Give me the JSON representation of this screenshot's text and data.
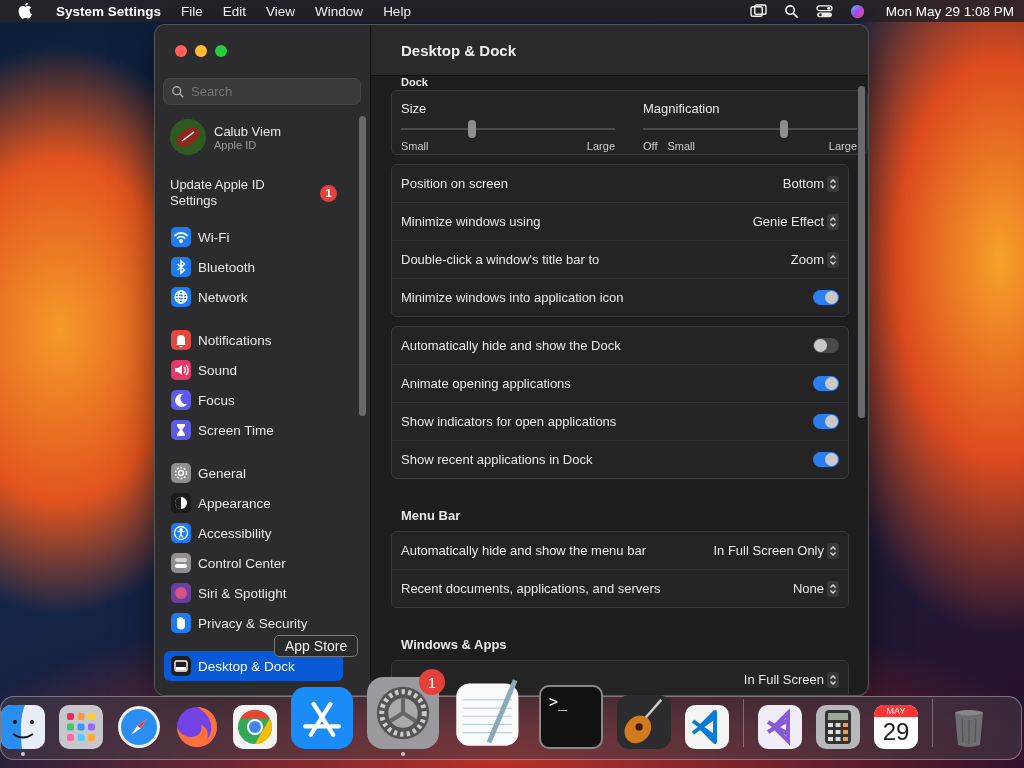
{
  "menu_bar": {
    "app_name": "System Settings",
    "menus": [
      "File",
      "Edit",
      "View",
      "Window",
      "Help"
    ],
    "clock": "Mon May 29  1:08 PM"
  },
  "window": {
    "title": "Desktop & Dock",
    "sidebar": {
      "search": {
        "placeholder": "Search"
      },
      "account": {
        "name": "Calub Viem",
        "subtitle": "Apple ID"
      },
      "notice": {
        "label": "Update Apple ID Settings",
        "badge": "1"
      },
      "groups": [
        [
          {
            "label": "Wi-Fi",
            "kind": "wifi",
            "color": "#1e7cf2",
            "selected": false
          },
          {
            "label": "Bluetooth",
            "kind": "bluetooth",
            "color": "#1e7cf2",
            "selected": false
          },
          {
            "label": "Network",
            "kind": "globe",
            "color": "#1e7cf2",
            "selected": false
          }
        ],
        [
          {
            "label": "Notifications",
            "kind": "bell",
            "color": "#e8453c",
            "selected": false
          },
          {
            "label": "Sound",
            "kind": "speaker",
            "color": "#e8386a",
            "selected": false
          },
          {
            "label": "Focus",
            "kind": "moon",
            "color": "#5e5ce6",
            "selected": false
          },
          {
            "label": "Screen Time",
            "kind": "hourglass",
            "color": "#5e5ce6",
            "selected": false
          }
        ],
        [
          {
            "label": "General",
            "kind": "gear",
            "color": "#8e8e93",
            "selected": false
          },
          {
            "label": "Appearance",
            "kind": "contrast",
            "color": "#1c1c1e",
            "selected": false
          },
          {
            "label": "Accessibility",
            "kind": "person",
            "color": "#1e7cf2",
            "selected": false
          },
          {
            "label": "Control Center",
            "kind": "switches",
            "color": "#8e8e93",
            "selected": false
          },
          {
            "label": "Siri & Spotlight",
            "kind": "orb",
            "color": "#6b3fa0",
            "selected": false
          },
          {
            "label": "Privacy & Security",
            "kind": "hand",
            "color": "#1e7cf2",
            "selected": false
          }
        ],
        [
          {
            "label": "Desktop & Dock",
            "kind": "dock",
            "color": "#1c1c1e",
            "selected": true
          }
        ]
      ]
    },
    "sections": [
      {
        "heading": "Dock",
        "sliders": [
          {
            "label": "Size",
            "level": 0.33,
            "scale": [
              "Small",
              "Large"
            ]
          },
          {
            "label": "Magnification",
            "level": 0.66,
            "scale": [
              "Off",
              "Small",
              "Large"
            ]
          }
        ],
        "groups": [
          [
            {
              "kind": "popup",
              "label": "Position on screen",
              "value": "Bottom"
            },
            {
              "kind": "popup",
              "label": "Minimize windows using",
              "value": "Genie Effect"
            },
            {
              "kind": "popup",
              "label": "Double-click a window's title bar to",
              "value": "Zoom"
            },
            {
              "kind": "toggle",
              "label": "Minimize windows into application icon",
              "on": true
            }
          ],
          [
            {
              "kind": "toggle",
              "label": "Automatically hide and show the Dock",
              "on": false
            },
            {
              "kind": "toggle",
              "label": "Animate opening applications",
              "on": true
            },
            {
              "kind": "toggle",
              "label": "Show indicators for open applications",
              "on": true
            },
            {
              "kind": "toggle",
              "label": "Show recent applications in Dock",
              "on": true
            }
          ]
        ]
      },
      {
        "heading": "Menu Bar",
        "groups": [
          [
            {
              "kind": "popup",
              "label": "Automatically hide and show the menu bar",
              "value": "In Full Screen Only"
            },
            {
              "kind": "popup",
              "label": "Recent documents, applications, and servers",
              "value": "None"
            }
          ]
        ]
      },
      {
        "heading": "Windows & Apps",
        "groups": [
          [
            {
              "kind": "popup",
              "value": "In Full Screen"
            }
          ]
        ]
      }
    ]
  },
  "tooltip": "App Store",
  "dock": {
    "apps": [
      {
        "kind": "finder",
        "running": true
      },
      {
        "kind": "launchpad"
      },
      {
        "kind": "compass"
      },
      {
        "kind": "firefox"
      },
      {
        "kind": "chrome"
      },
      {
        "kind": "appstore"
      },
      {
        "kind": "settings",
        "running": true,
        "badge": "1"
      },
      {
        "kind": "textedit"
      },
      {
        "kind": "terminal",
        "glyph": ">_"
      },
      {
        "kind": "guitar"
      },
      {
        "kind": "vscode"
      },
      {
        "kind": "divider"
      },
      {
        "kind": "vstudio"
      },
      {
        "kind": "calculator"
      },
      {
        "kind": "calendar",
        "month": "MAY",
        "day": "29"
      },
      {
        "kind": "divider"
      },
      {
        "kind": "trash"
      }
    ]
  }
}
